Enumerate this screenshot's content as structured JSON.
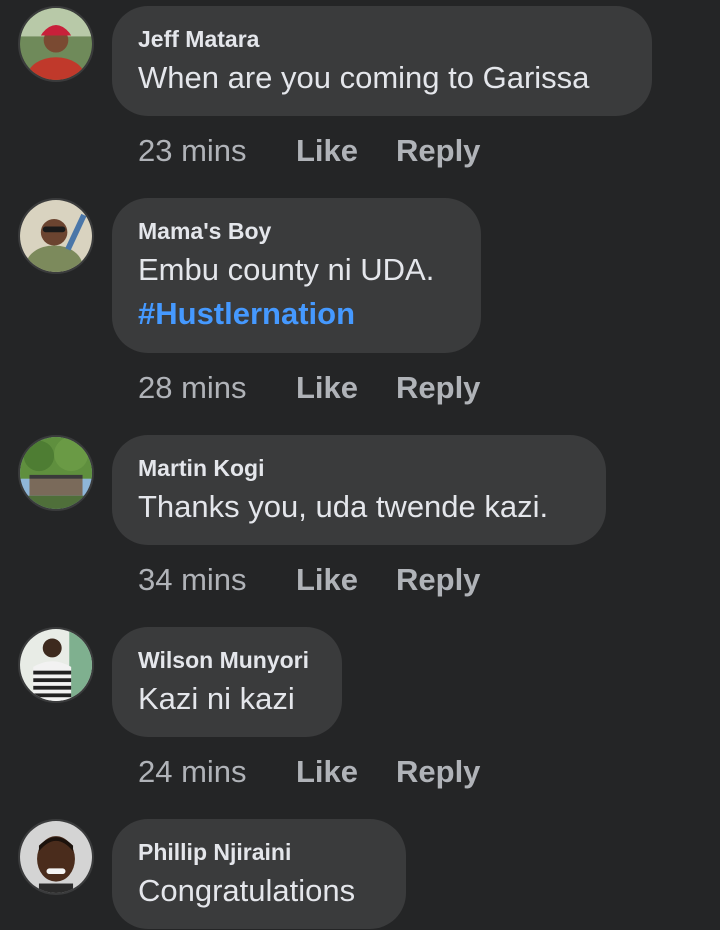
{
  "comments": [
    {
      "author": "Jeff Matara",
      "text": "When are you coming to Garissa",
      "hashtag": "",
      "time": "23 mins",
      "like_label": "Like",
      "reply_label": "Reply"
    },
    {
      "author": "Mama's Boy",
      "text": "Embu county ni UDA.",
      "hashtag": "#Hustlernation",
      "time": "28 mins",
      "like_label": "Like",
      "reply_label": "Reply"
    },
    {
      "author": "Martin Kogi",
      "text": "Thanks you, uda twende kazi.",
      "hashtag": "",
      "time": "34 mins",
      "like_label": "Like",
      "reply_label": "Reply"
    },
    {
      "author": "Wilson Munyori",
      "text": "Kazi ni kazi",
      "hashtag": "",
      "time": "24 mins",
      "like_label": "Like",
      "reply_label": "Reply"
    },
    {
      "author": "Phillip Njiraini",
      "text": "Congratulations",
      "hashtag": "",
      "time": "",
      "like_label": "",
      "reply_label": ""
    }
  ],
  "colors": {
    "background": "#242526",
    "bubble": "#3a3b3c",
    "text": "#e4e6eb",
    "secondary": "#b0b3b8",
    "hashtag": "#4599ff"
  }
}
